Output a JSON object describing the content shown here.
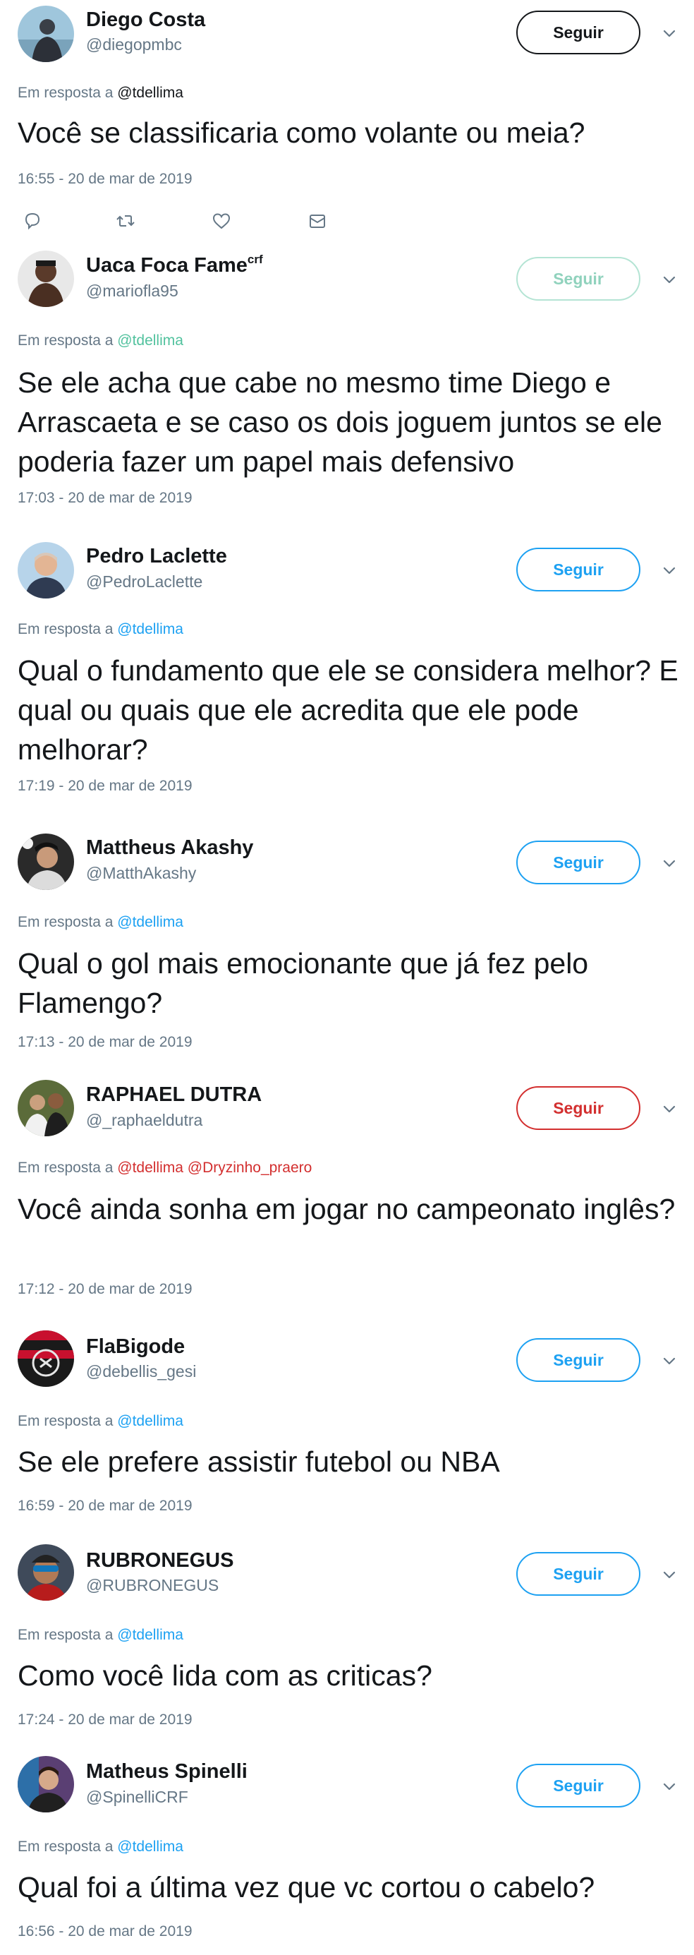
{
  "ui": {
    "follow_label": "Seguir",
    "reply_prefix": "Em resposta a"
  },
  "tweets": [
    {
      "name": "Diego Costa",
      "handle": "@diegopmbc",
      "mentions": "@tdellima",
      "text": "Você se classificaria como volante ou meia?",
      "time": "16:55 - 20 de mar de 2019",
      "actions": [
        "reply-icon",
        "retweet-icon",
        "like-icon",
        "message-icon"
      ]
    },
    {
      "name": "Uaca Foca Fame",
      "name_sup": "crf",
      "handle": "@mariofla95",
      "mentions": "@tdellima",
      "text": "Se ele acha que cabe no mesmo time Diego e Arrascaeta e se caso os dois joguem juntos se ele poderia fazer um papel mais defensivo",
      "time": "17:03 - 20 de mar de 2019"
    },
    {
      "name": "Pedro Laclette",
      "handle": "@PedroLaclette",
      "mentions": "@tdellima",
      "text": "Qual o fundamento que ele se considera melhor? E qual ou quais que ele acredita que ele pode melhorar?",
      "time": "17:19 - 20 de mar de 2019"
    },
    {
      "name": "Mattheus Akashy",
      "handle": "@MatthAkashy",
      "mentions": "@tdellima",
      "text": "Qual o gol mais emocionante que já fez pelo Flamengo?",
      "time": "17:13 - 20 de mar de 2019"
    },
    {
      "name": "RAPHAEL DUTRA",
      "handle": "@_raphaeldutra",
      "mentions": "@tdellima @Dryzinho_praero",
      "text": "Você ainda sonha em jogar no campeonato inglês?",
      "time": "17:12 - 20 de mar de 2019"
    },
    {
      "name": "FlaBigode",
      "handle": "@debellis_gesi",
      "mentions": "@tdellima",
      "text": "Se ele prefere assistir futebol ou NBA",
      "time": "16:59 - 20 de mar de 2019"
    },
    {
      "name": "RUBRONEGUS",
      "handle": "@RUBRONEGUS",
      "mentions": "@tdellima",
      "text": "Como você lida com as criticas?",
      "time": "17:24 - 20 de mar de 2019"
    },
    {
      "name": "Matheus Spinelli",
      "handle": "@SpinelliCRF",
      "mentions": "@tdellima",
      "text": "Qual foi a última vez que vc cortou o cabelo?",
      "time": "16:56 - 20 de mar de 2019"
    }
  ]
}
